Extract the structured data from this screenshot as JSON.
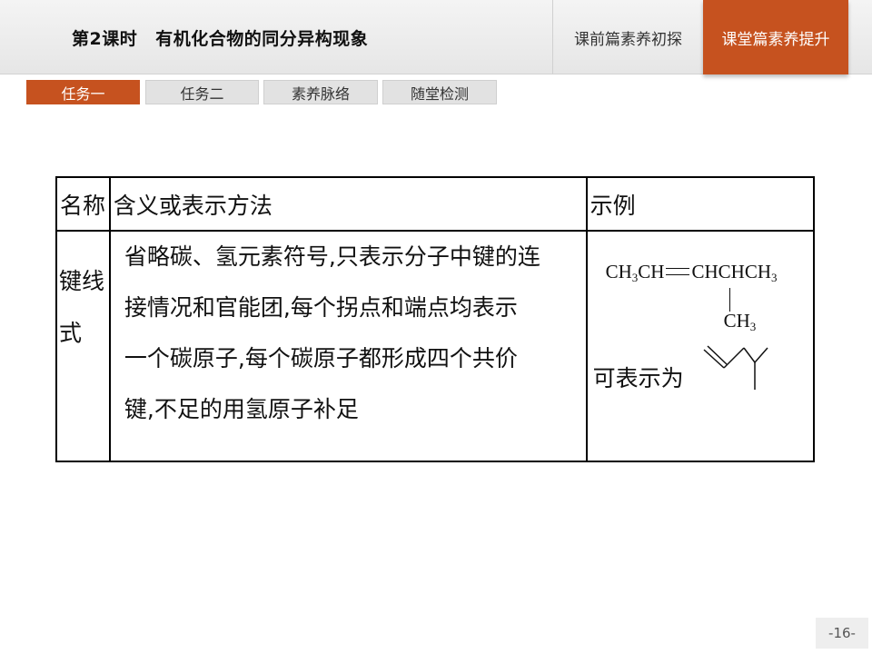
{
  "header": {
    "lesson_number": "第2课时",
    "lesson_title": "有机化合物的同分异构现象",
    "nav_prev": "课前篇素养初探",
    "nav_current": "课堂篇素养提升"
  },
  "tabs": [
    {
      "label": "任务一",
      "active": true
    },
    {
      "label": "任务二",
      "active": false
    },
    {
      "label": "素养脉络",
      "active": false
    },
    {
      "label": "随堂检测",
      "active": false
    }
  ],
  "table": {
    "headers": [
      "名称",
      "含义或表示方法",
      "示例"
    ],
    "row": {
      "name_lines": [
        "键线",
        "式"
      ],
      "description_lines": [
        "省略碳、氢元素符号,只表示分子中键的连",
        "接情况和官能团,每个拐点和端点均表示",
        "一个碳原子,每个碳原子都形成四个共价",
        "键,不足的用氢原子补足"
      ],
      "example": {
        "formula_main": {
          "ch3_a": "CH",
          "sub_a": "3",
          "ch_b": "CH",
          "chchch3": "CHCHCH",
          "sub_c": "3"
        },
        "branch": {
          "ch": "CH",
          "sub": "3"
        },
        "represent_text": "可表示为",
        "skeletal_icon": "skeletal-formula-zigzag"
      }
    }
  },
  "page_number": "-16-",
  "colors": {
    "accent": "#c6521f",
    "header_bg": "#ececec",
    "tab_inactive": "#e2e2e2"
  }
}
